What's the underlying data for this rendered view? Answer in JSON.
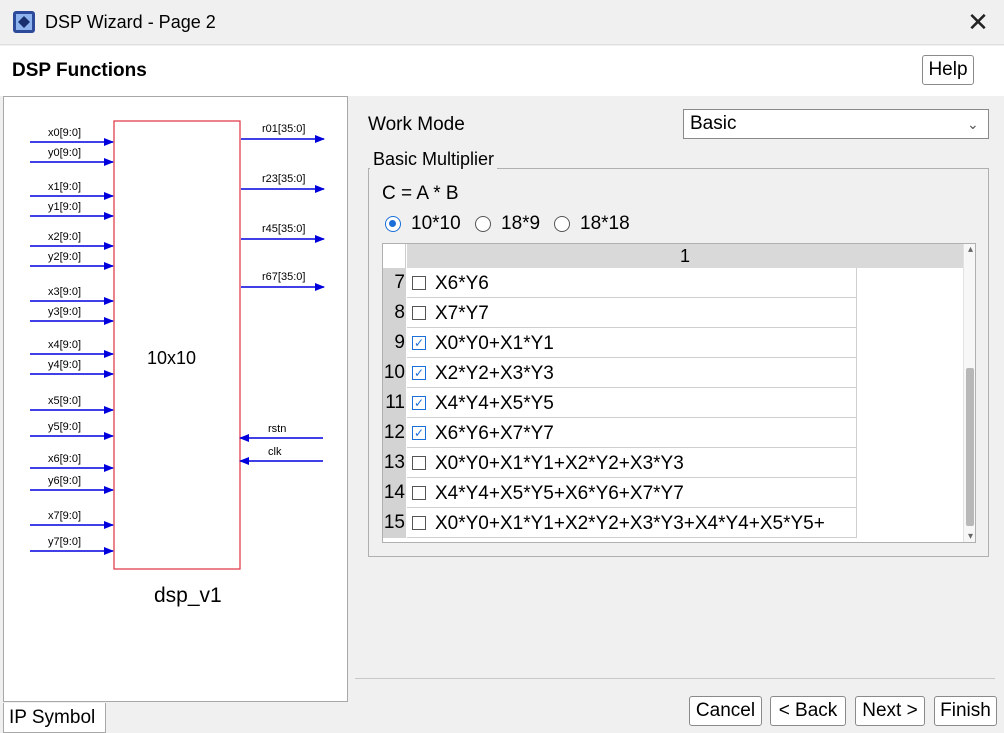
{
  "window": {
    "title": "DSP Wizard - Page 2",
    "close_glyph": "✕"
  },
  "header": {
    "title": "DSP Functions",
    "help_label": "Help"
  },
  "symbol": {
    "block_label": "10x10",
    "instance_name": "dsp_v1",
    "inputs": [
      "x0[9:0]",
      "y0[9:0]",
      "x1[9:0]",
      "y1[9:0]",
      "x2[9:0]",
      "y2[9:0]",
      "x3[9:0]",
      "y3[9:0]",
      "x4[9:0]",
      "y4[9:0]",
      "x5[9:0]",
      "y5[9:0]",
      "x6[9:0]",
      "y6[9:0]",
      "x7[9:0]",
      "y7[9:0]"
    ],
    "outputs": [
      "r01[35:0]",
      "r23[35:0]",
      "r45[35:0]",
      "r67[35:0]"
    ],
    "controls": [
      "rstn",
      "clk"
    ],
    "tab_label": "IP Symbol"
  },
  "work_mode": {
    "label": "Work Mode",
    "value": "Basic",
    "chevron": "⌄"
  },
  "multiplier": {
    "group_label": "Basic Multiplier",
    "formula": "C  = A * B",
    "options": [
      {
        "label": "10*10",
        "selected": true
      },
      {
        "label": "18*9",
        "selected": false
      },
      {
        "label": "18*18",
        "selected": false
      }
    ],
    "table": {
      "column_header": "1",
      "rows": [
        {
          "num": "7",
          "text": "X6*Y6",
          "checked": false
        },
        {
          "num": "8",
          "text": "X7*Y7",
          "checked": false
        },
        {
          "num": "9",
          "text": "X0*Y0+X1*Y1",
          "checked": true
        },
        {
          "num": "10",
          "text": "X2*Y2+X3*Y3",
          "checked": true
        },
        {
          "num": "11",
          "text": "X4*Y4+X5*Y5",
          "checked": true
        },
        {
          "num": "12",
          "text": "X6*Y6+X7*Y7",
          "checked": true
        },
        {
          "num": "13",
          "text": "X0*Y0+X1*Y1+X2*Y2+X3*Y3",
          "checked": false
        },
        {
          "num": "14",
          "text": "X4*Y4+X5*Y5+X6*Y6+X7*Y7",
          "checked": false
        },
        {
          "num": "15",
          "text": "X0*Y0+X1*Y1+X2*Y2+X3*Y3+X4*Y4+X5*Y5+",
          "checked": false
        }
      ],
      "scroll_up": "▴",
      "scroll_down": "▾"
    }
  },
  "footer": {
    "cancel": "Cancel",
    "back": "< Back",
    "next": "Next >",
    "finish": "Finish"
  },
  "colors": {
    "wire": "#0000dd",
    "block_border": "#e03040",
    "accent": "#1a6fd8"
  }
}
